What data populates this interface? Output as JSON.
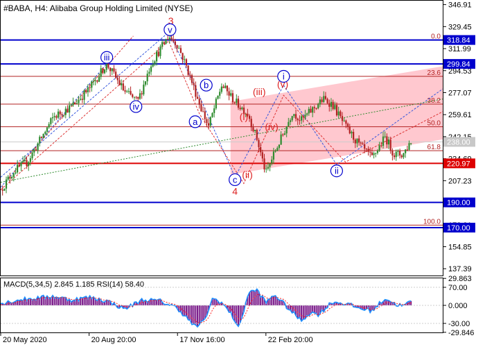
{
  "header": {
    "title": "#BABA, H4:  Alibaba Group Holding Limited (NYSE)"
  },
  "indicator": {
    "label": "MACD(5,34,5) 2.845 1.185 RSI(14) 58.40"
  },
  "colors": {
    "background": "#ffffff",
    "axis": "#000000",
    "fib_line": "#b22222",
    "support_line": "#0000cd",
    "wave_label": "#0000cd",
    "wave_label_red": "#dd2222",
    "channel_fill": "#ff9aa8",
    "candle_up": "#2e8b2e",
    "candle_down": "#b22222",
    "macd_hist": "#7a1a8a",
    "macd_line": "#1e90ff",
    "signal_line": "#ff2020"
  },
  "chart_data": [
    {
      "type": "candlestick",
      "title": "#BABA, H4:  Alibaba Group Holding Limited (NYSE)",
      "x_tick_labels": [
        "20 May 2020",
        "20 Aug 20:00",
        "17 Nov 16:00",
        "22 Feb 20:00"
      ],
      "y_tick_labels": [
        "346.91",
        "329.45",
        "311.99",
        "294.53",
        "277.07",
        "259.61",
        "242.15",
        "224.69",
        "207.23",
        "189.77",
        "172.31",
        "154.85",
        "137.39"
      ],
      "ylim": [
        132,
        350
      ],
      "price_path": [
        [
          0,
          200
        ],
        [
          3,
          215
        ],
        [
          6,
          222
        ],
        [
          9,
          240
        ],
        [
          12,
          258
        ],
        [
          16,
          266
        ],
        [
          20,
          280
        ],
        [
          24,
          300
        ],
        [
          28,
          278
        ],
        [
          31,
          270
        ],
        [
          34,
          300
        ],
        [
          38,
          322
        ],
        [
          40,
          315
        ],
        [
          42,
          298
        ],
        [
          45,
          268
        ],
        [
          47,
          250
        ],
        [
          50,
          283
        ],
        [
          53,
          270
        ],
        [
          56,
          260
        ],
        [
          58,
          240
        ],
        [
          60,
          213
        ],
        [
          62,
          230
        ],
        [
          64,
          245
        ],
        [
          66,
          262
        ],
        [
          68,
          255
        ],
        [
          70,
          262
        ],
        [
          73,
          272
        ],
        [
          75,
          268
        ],
        [
          78,
          250
        ],
        [
          81,
          236
        ],
        [
          84,
          225
        ],
        [
          87,
          242
        ],
        [
          89,
          228
        ],
        [
          91,
          228
        ],
        [
          93,
          240
        ]
      ],
      "horizontal_levels": [
        {
          "value": 318.84,
          "label": "318.84",
          "style": "support",
          "badge": true
        },
        {
          "value": 299.84,
          "label": "299.84",
          "style": "support",
          "badge": true
        },
        {
          "value": 238.0,
          "label": "238.00",
          "style": "current",
          "badge": true
        },
        {
          "value": 220.97,
          "label": "220.97",
          "style": "fib",
          "badge": true
        },
        {
          "value": 190.0,
          "label": "190.00",
          "style": "support",
          "badge": true
        },
        {
          "value": 170.0,
          "label": "170.00",
          "style": "support",
          "badge": true
        }
      ],
      "fib_levels": [
        {
          "label": "0.0",
          "value": 318.84
        },
        {
          "label": "23.6",
          "value": 290.0
        },
        {
          "label": "38.2",
          "value": 268.0
        },
        {
          "label": "50.0",
          "value": 250.0
        },
        {
          "label": "61.8",
          "value": 231.0
        },
        {
          "label": "100.0",
          "value": 172.0
        }
      ],
      "wave_labels": [
        {
          "text": "3",
          "x": 38.5,
          "y": 334,
          "style": "red"
        },
        {
          "text": "v",
          "x": 38.3,
          "y": 327,
          "style": "circled"
        },
        {
          "text": "iii",
          "x": 24.0,
          "y": 305,
          "style": "circled"
        },
        {
          "text": "iv",
          "x": 30.6,
          "y": 266,
          "style": "circled"
        },
        {
          "text": "b",
          "x": 46.5,
          "y": 283,
          "style": "circled"
        },
        {
          "text": "a",
          "x": 44.0,
          "y": 254,
          "style": "circled"
        },
        {
          "text": "c",
          "x": 53.0,
          "y": 208,
          "style": "circled"
        },
        {
          "text": "4",
          "x": 53.0,
          "y": 199,
          "style": "red"
        },
        {
          "text": "(ii)",
          "x": 55.8,
          "y": 212,
          "style": "red"
        },
        {
          "text": "(i)",
          "x": 55.0,
          "y": 258,
          "style": "red"
        },
        {
          "text": "(iii)",
          "x": 58.5,
          "y": 278,
          "style": "red"
        },
        {
          "text": "(iv)",
          "x": 61.3,
          "y": 250,
          "style": "red"
        },
        {
          "text": "(v)",
          "x": 63.8,
          "y": 284,
          "style": "red"
        },
        {
          "text": "i",
          "x": 64.0,
          "y": 290,
          "style": "circled"
        },
        {
          "text": "ii",
          "x": 76.0,
          "y": 215,
          "style": "circled"
        }
      ]
    },
    {
      "type": "histogram",
      "title": "MACD(5,34,5) 2.845 1.185 RSI(14) 58.40",
      "y_tick_labels": [
        "29.863",
        "70.00",
        "0.000",
        "-30.00",
        "-29.846"
      ],
      "ylim": [
        -30,
        30
      ],
      "macd_path": [
        [
          0,
          2
        ],
        [
          4,
          6
        ],
        [
          8,
          8
        ],
        [
          12,
          10
        ],
        [
          16,
          6
        ],
        [
          20,
          9
        ],
        [
          24,
          5
        ],
        [
          28,
          -4
        ],
        [
          32,
          6
        ],
        [
          36,
          5
        ],
        [
          40,
          -3
        ],
        [
          44,
          -24
        ],
        [
          46,
          -18
        ],
        [
          48,
          8
        ],
        [
          50,
          3
        ],
        [
          52,
          -9
        ],
        [
          54,
          -25
        ],
        [
          56,
          14
        ],
        [
          58,
          17
        ],
        [
          60,
          3
        ],
        [
          62,
          12
        ],
        [
          64,
          2
        ],
        [
          66,
          -8
        ],
        [
          68,
          -17
        ],
        [
          70,
          -8
        ],
        [
          72,
          -10
        ],
        [
          75,
          4
        ],
        [
          78,
          2
        ],
        [
          81,
          -3
        ],
        [
          84,
          -6
        ],
        [
          87,
          8
        ],
        [
          89,
          2
        ],
        [
          91,
          -1
        ],
        [
          93,
          5
        ]
      ]
    }
  ]
}
